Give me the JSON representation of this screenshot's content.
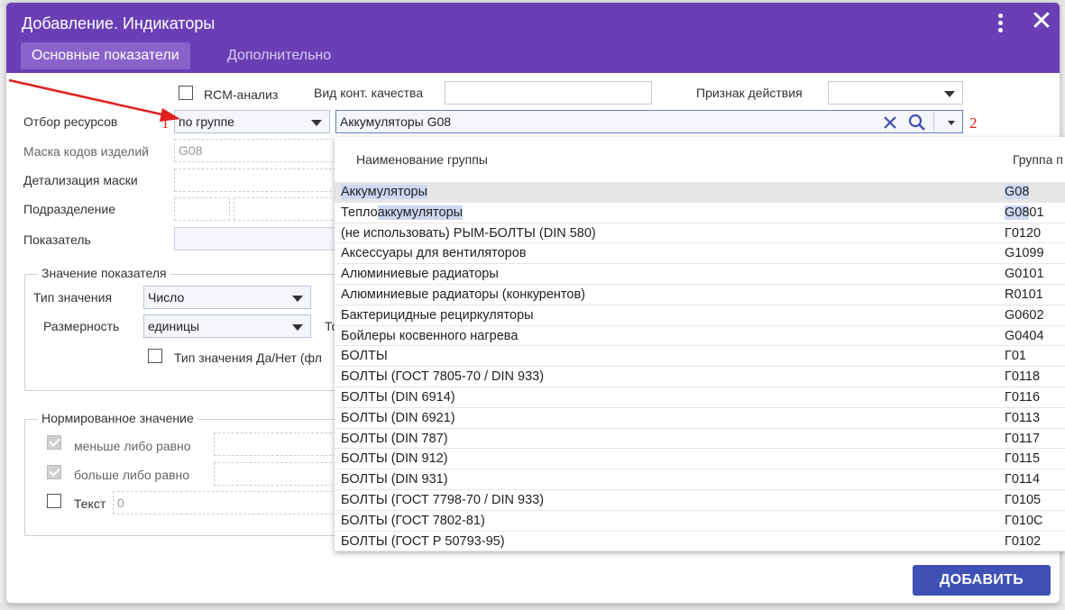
{
  "dialog": {
    "title": "Добавление. Индикаторы",
    "tabs": [
      "Основные показатели",
      "Дополнительно"
    ]
  },
  "form": {
    "rcm_label": "RCM-анализ",
    "control_type_label": "Вид конт. качества",
    "action_label": "Признак действия",
    "resource_filter_label": "Отбор ресурсов",
    "resource_filter_value": "по группе",
    "group_value": "Аккумуляторы G08",
    "mask_label": "Маска кодов изделий",
    "mask_value": "G08",
    "detail_label": "Детализация маски",
    "division_label": "Подразделение",
    "indicator_label": "Показатель",
    "value_group": {
      "legend": "Значение показателя",
      "type_label": "Тип  значения",
      "type_value": "Число",
      "dimension_label": "Размерность",
      "dimension_value": "единицы",
      "partial_label": "То",
      "bool_label": "Тип значения Да/Нет (фл"
    },
    "norm_group": {
      "legend": "Нормированное значение",
      "le_label": "меньше либо равно",
      "ge_label": "больше либо равно",
      "text_label": "Текст",
      "text_value": "0"
    }
  },
  "annotations": {
    "mark1": "1",
    "mark2": "2"
  },
  "dropdown": {
    "col1": "Наименование группы",
    "col2": "Группа п",
    "rows": [
      {
        "name": "Аккумуляторы",
        "code": "G08",
        "name_pre": "",
        "name_hl": "Аккумуляторы",
        "name_post": "",
        "code_hl": "G08",
        "code_post": ""
      },
      {
        "name": "Теплоаккумуляторы",
        "code": "G0801",
        "name_pre": "Тепло",
        "name_hl": "аккумуляторы",
        "name_post": "",
        "code_hl": "G08",
        "code_post": "01"
      },
      {
        "name": "(не использовать) РЫМ-БОЛТЫ (DIN 580)",
        "code": "Г0120"
      },
      {
        "name": "Аксессуары для вентиляторов",
        "code": "G1099"
      },
      {
        "name": "Алюминиевые радиаторы",
        "code": "G0101"
      },
      {
        "name": "Алюминиевые радиаторы (конкурентов)",
        "code": "R0101"
      },
      {
        "name": "Бактерицидные рециркуляторы",
        "code": "G0602"
      },
      {
        "name": "Бойлеры косвенного нагрева",
        "code": "G0404"
      },
      {
        "name": "БОЛТЫ",
        "code": "Г01"
      },
      {
        "name": "БОЛТЫ (ГОСТ 7805-70 / DIN 933)",
        "code": "Г0118"
      },
      {
        "name": "БОЛТЫ (DIN 6914)",
        "code": "Г0116"
      },
      {
        "name": "БОЛТЫ (DIN 6921)",
        "code": "Г0113"
      },
      {
        "name": "БОЛТЫ (DIN 787)",
        "code": "Г0117"
      },
      {
        "name": "БОЛТЫ (DIN 912)",
        "code": "Г0115"
      },
      {
        "name": "БОЛТЫ (DIN 931)",
        "code": "Г0114"
      },
      {
        "name": "БОЛТЫ (ГОСТ 7798-70 / DIN 933)",
        "code": "Г0105"
      },
      {
        "name": "БОЛТЫ (ГОСТ 7802-81)",
        "code": "Г010С"
      },
      {
        "name": "БОЛТЫ (ГОСТ Р 50793-95)",
        "code": "Г0102"
      }
    ]
  },
  "add_button": "ДОБАВИТЬ",
  "colors": {
    "header": "#6a3fb6",
    "accent": "#3f51b5",
    "annotation": "#e02020"
  }
}
